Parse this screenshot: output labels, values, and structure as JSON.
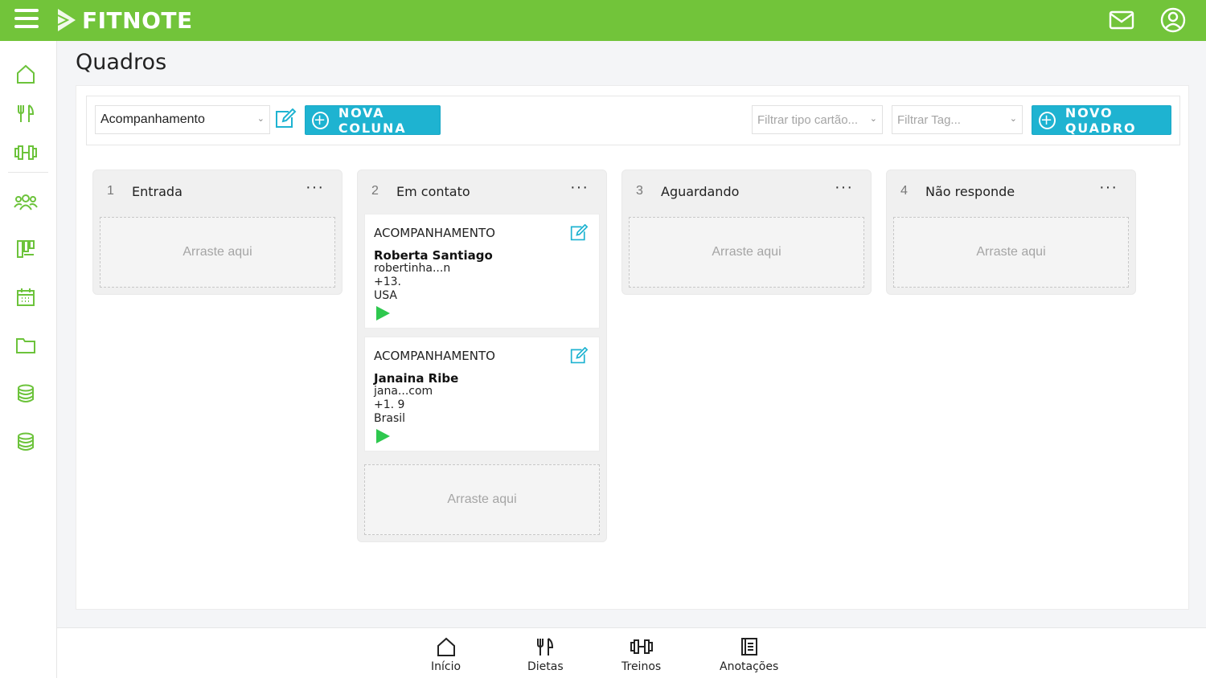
{
  "app": {
    "logo_text": "FITNOTE",
    "brand_color": "#72c43a",
    "accent_color": "#1eb3d1"
  },
  "topbar": {
    "icons": [
      "menu-icon",
      "mail-icon",
      "user-icon"
    ]
  },
  "sidebar": {
    "items": [
      "home-icon",
      "diet-icon",
      "workout-icon",
      "clients-icon",
      "boards-icon",
      "calendar-icon",
      "folder-icon",
      "database-icon",
      "database-icon"
    ]
  },
  "page": {
    "title": "Quadros"
  },
  "toolbar": {
    "board_select": "Acompanhamento",
    "new_column_label": "NOVA COLUNA",
    "filter_card_type": "Filtrar tipo cartão...",
    "filter_tag": "Filtrar Tag...",
    "new_board_label": "NOVO QUADRO"
  },
  "columns": [
    {
      "number": "1",
      "title": "Entrada",
      "more": "···",
      "drop_label": "Arraste aqui"
    },
    {
      "number": "2",
      "title": "Em contato",
      "more": "···",
      "drop_label": "Arraste aqui",
      "cards": [
        {
          "type": "ACOMPANHAMENTO",
          "name": "Roberta Santiago",
          "email": "robertinha...n",
          "phone": "+13.",
          "country": "USA"
        },
        {
          "type": "ACOMPANHAMENTO",
          "name": "Janaina Ribe",
          "email": "jana...com",
          "phone": "+1.    9",
          "country": "Brasil"
        }
      ]
    },
    {
      "number": "3",
      "title": "Aguardando",
      "more": "···",
      "drop_label": "Arraste aqui"
    },
    {
      "number": "4",
      "title": "Não responde",
      "more": "···",
      "drop_label": "Arraste aqui"
    }
  ],
  "bottom_nav": [
    {
      "label": "Início",
      "icon": "home-icon"
    },
    {
      "label": "Dietas",
      "icon": "diet-icon"
    },
    {
      "label": "Treinos",
      "icon": "workout-icon"
    },
    {
      "label": "Anotações",
      "icon": "notes-icon"
    }
  ]
}
